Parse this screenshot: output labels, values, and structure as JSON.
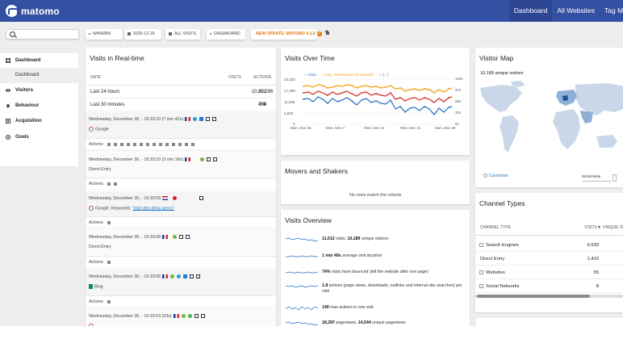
{
  "brand": {
    "name": "matomo"
  },
  "topnav": {
    "items": [
      "Dashboard",
      "All Websites",
      "Tag Manager"
    ]
  },
  "toolbar": {
    "site": "WIKIMINI",
    "date": "2020-12-29",
    "segment": "ALL VISITS",
    "dashboard": "DASHBOARD",
    "update": "NEW UPDATE: MATOMO 4.1.0"
  },
  "sidebar": {
    "dashboard": "Dashboard",
    "dashboard_sub": "Dashboard",
    "visitors": "Visitors",
    "behaviour": "Behaviour",
    "acquisition": "Acquisition",
    "goals": "Goals"
  },
  "realtime": {
    "title": "Visits in Real-time",
    "col_date": "DATE",
    "col_visits": "VISITS",
    "col_actions": "ACTIONS",
    "rows": [
      {
        "label": "Last 24 hours",
        "visits": "10,921",
        "actions": "20,296"
      },
      {
        "label": "Last 30 minutes",
        "visits": "409",
        "actions": "784"
      }
    ],
    "actions_label": "Actions:",
    "visits": [
      {
        "time": "Wednesday, December 30, - 16:33:10 (7 min 42s)",
        "referrer": "Google"
      },
      {
        "time": "Wednesday, December 30, - 16:33:10 (3 min 18s)",
        "referrer": "Direct Entry"
      },
      {
        "time": "Wednesday, December 30, - 16:33:09",
        "referrer": "Google, Keywords:",
        "keyword": "\"liste des dieux grecs\""
      },
      {
        "time": "Wednesday, December 30, - 16:33:08",
        "referrer": "Direct Entry"
      },
      {
        "time": "Wednesday, December 30, - 16:33:05",
        "referrer": "Bing"
      },
      {
        "time": "Wednesday, December 30, - 16:33:03 (23s)",
        "referrer": ""
      }
    ]
  },
  "visits_over_time": {
    "title": "Visits Over Time",
    "legend": [
      "Visits",
      "Avg. Visit Duration (in seconds)",
      "[...]"
    ],
    "colors": {
      "visits": "#1f6ec2",
      "duration": "#f59c00",
      "third": "#d4291f"
    },
    "y_left": [
      "23,330",
      "17,498",
      "11,665",
      "5,833",
      "0"
    ],
    "y_right": [
      "130s",
      "97s",
      "65s",
      "32s",
      "0s"
    ],
    "x_labels": [
      "Mon, Nov 30",
      "Mon, Dec 7",
      "Mon, Dec 14",
      "Mon, Dec 21",
      "Mon, Dec 28"
    ]
  },
  "movers": {
    "title": "Movers and Shakers",
    "empty": "No rows match the criteria"
  },
  "overview": {
    "title": "Visits Overview",
    "rows": [
      {
        "value": "11,012",
        "text": " visits, ",
        "value2": "10,189",
        "text2": " unique visitors"
      },
      {
        "value": "1 min 49s",
        "text": " average visit duration",
        "value2": "",
        "text2": ""
      },
      {
        "value": "74%",
        "text": " visits have bounced (left the website after one page)",
        "value2": "",
        "text2": ""
      },
      {
        "value": "1.8",
        "text": " actions (page views, downloads, outlinks and internal site searches) per visit",
        "value2": "",
        "text2": ""
      },
      {
        "value": "149",
        "text": " max actions in one visit",
        "value2": "",
        "text2": ""
      },
      {
        "value": "18,287",
        "text": " pageviews, ",
        "value2": "14,544",
        "text2": " unique pageviews"
      }
    ]
  },
  "visitor_map": {
    "title": "Visitor Map",
    "caption": "10,189 unique visitors",
    "link": "Countries",
    "select": "World-Wide"
  },
  "channels": {
    "title": "Channel Types",
    "col_type": "CHANNEL TYPE",
    "col_visits": "VISITS",
    "col_unique": "UNIQUE VISITORS",
    "rows": [
      {
        "name": "Search Engines",
        "visits": "9,539",
        "expandable": true
      },
      {
        "name": "Direct Entry",
        "visits": "1,410",
        "expandable": false
      },
      {
        "name": "Websites",
        "visits": "55",
        "expandable": true
      },
      {
        "name": "Social Networks",
        "visits": "8",
        "expandable": true
      }
    ]
  }
}
